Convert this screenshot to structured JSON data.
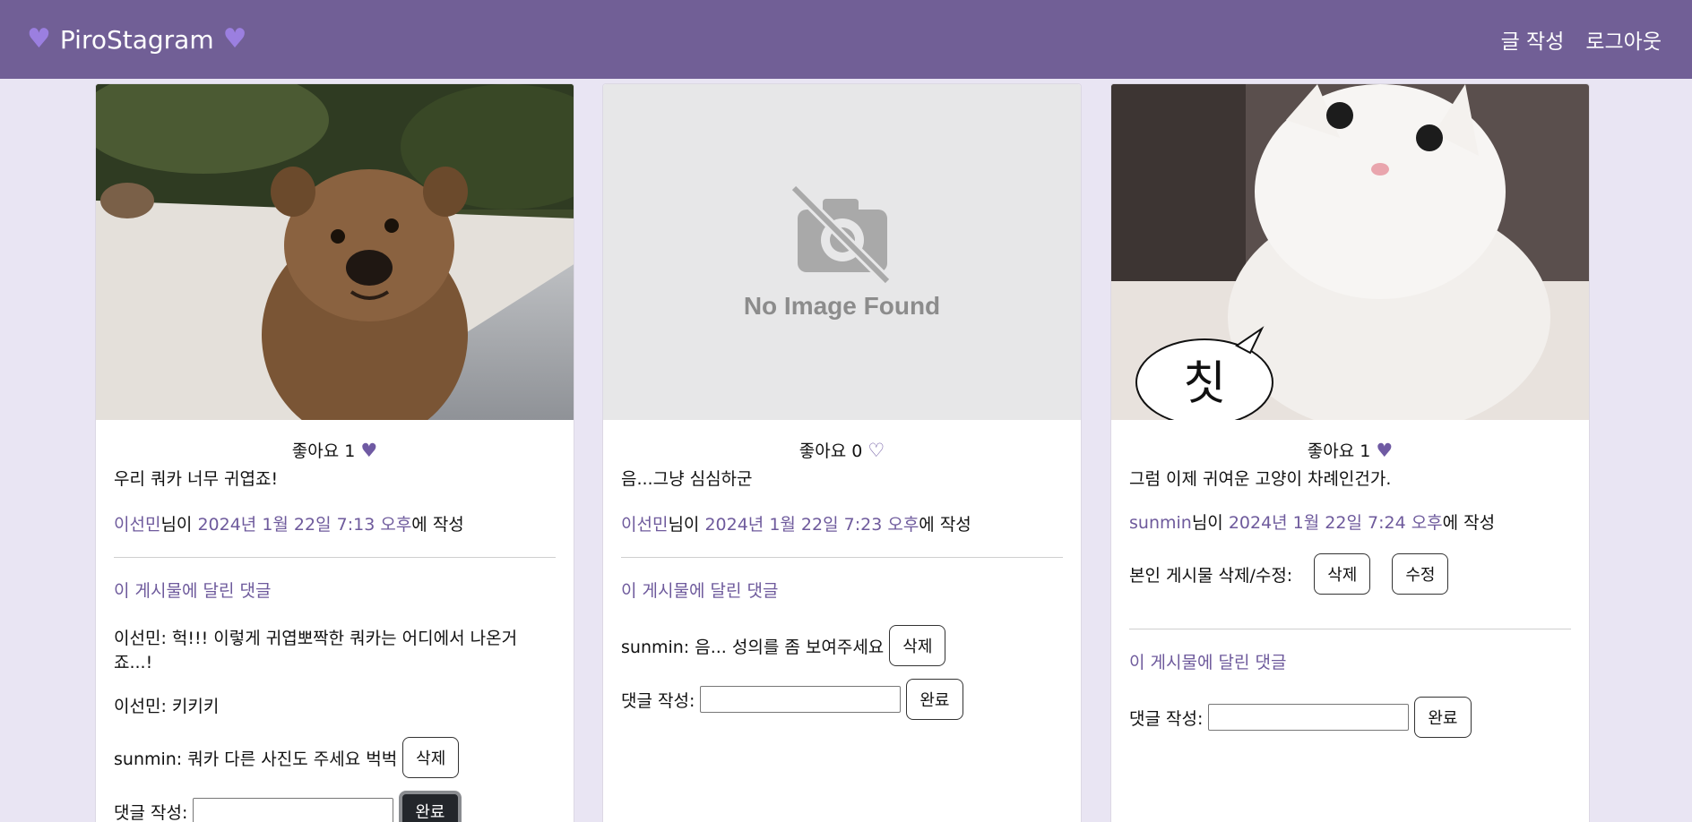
{
  "nav": {
    "brand": "PiroStagram",
    "links": [
      "글 작성",
      "로그아웃"
    ]
  },
  "colors": {
    "navbar": "#715f96",
    "accent": "#6e5a9c",
    "page_bg": "#e9e5f3"
  },
  "posts": [
    {
      "image": "quokka photo",
      "likes_label": "좋아요 1",
      "liked": true,
      "caption": "우리 쿼카 너무 귀엽죠!",
      "author": "이선민",
      "author_suffix": "님이 ",
      "date": "2024년 1월 22일 7:13 오후",
      "date_suffix": "에 작성",
      "comments_title": "이 게시물에 달린 댓글",
      "comments": [
        {
          "text": "이선민: 헉!!! 이렇게 귀엽뽀짝한 쿼카는 어디에서 나온거죠...!"
        },
        {
          "text": "이선민: 키키키"
        },
        {
          "text": "sunmin: 쿼카 다른 사진도 주세요 벅벅",
          "delete_label": "삭제"
        }
      ],
      "form_label": "댓글 작성:",
      "submit_label": "완료"
    },
    {
      "image": "no image",
      "no_image_text": "No Image Found",
      "likes_label": "좋아요 0",
      "liked": false,
      "caption": "음...그냥 심심하군",
      "author": "이선민",
      "author_suffix": "님이 ",
      "date": "2024년 1월 22일 7:23 오후",
      "date_suffix": "에 작성",
      "comments_title": "이 게시물에 달린 댓글",
      "comments": [
        {
          "text": "sunmin: 음... 성의를 좀 보여주세요",
          "delete_label": "삭제"
        }
      ],
      "form_label": "댓글 작성:",
      "submit_label": "완료"
    },
    {
      "image": "white cat photo",
      "bubble_text": "칫",
      "likes_label": "좋아요 1",
      "liked": true,
      "caption": "그럼 이제 귀여운 고양이 차례인건가.",
      "author": "sunmin",
      "author_suffix": "님이 ",
      "date": "2024년 1월 22일 7:24 오후",
      "date_suffix": "에 작성",
      "owner_label": "본인 게시물 삭제/수정:",
      "delete_label": "삭제",
      "edit_label": "수정",
      "comments_title": "이 게시물에 달린 댓글",
      "comments": [],
      "form_label": "댓글 작성:",
      "submit_label": "완료"
    }
  ]
}
